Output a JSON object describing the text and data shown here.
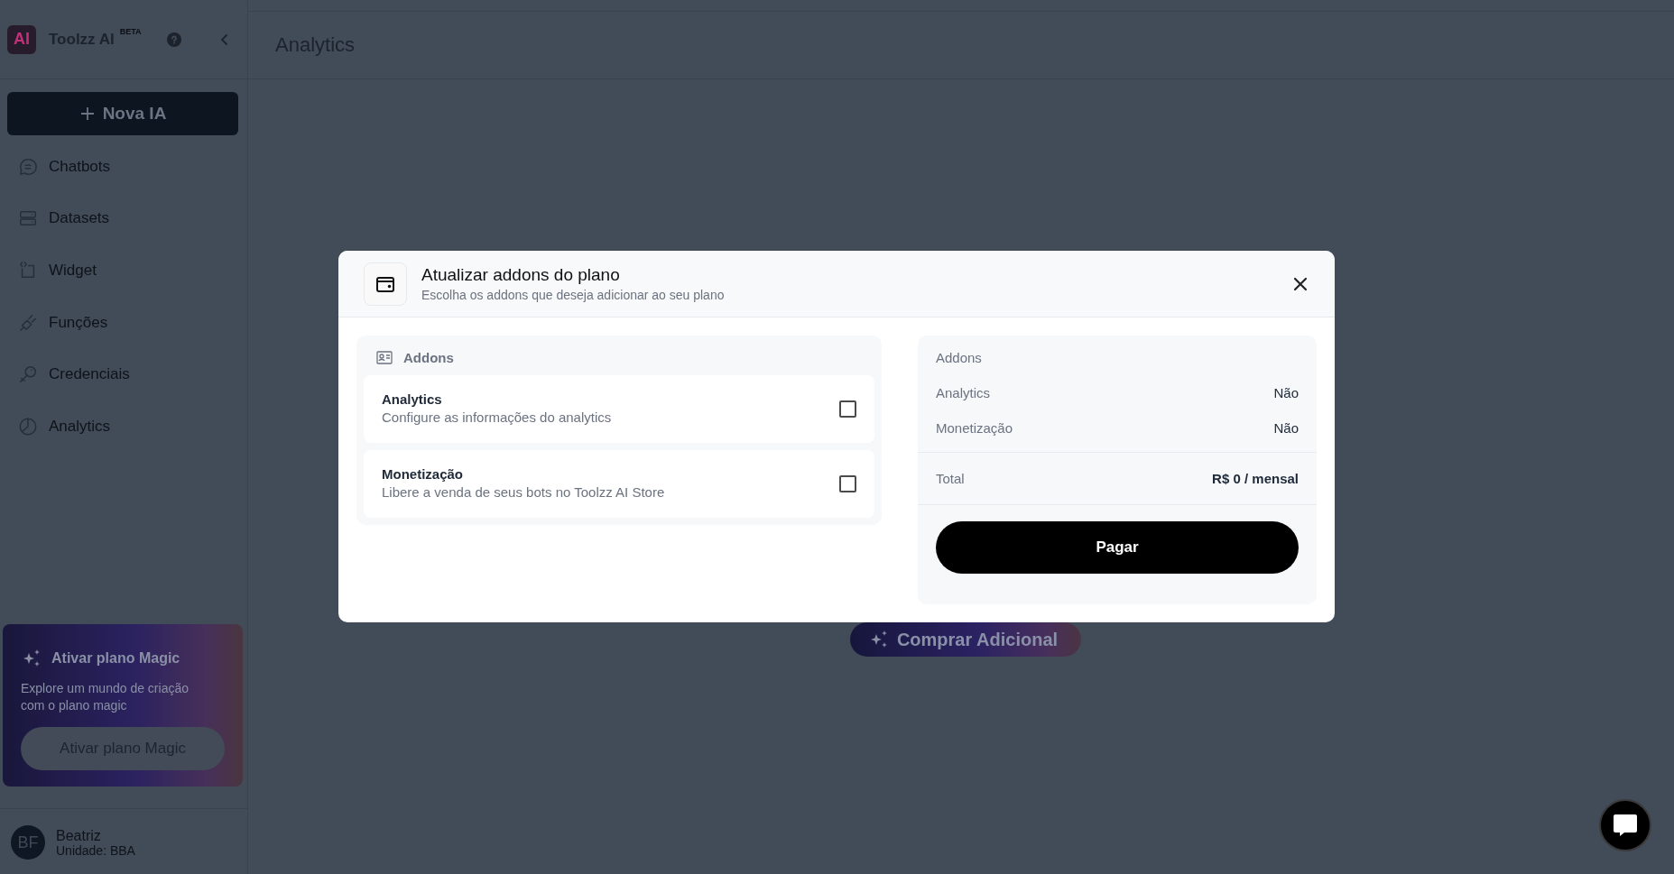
{
  "sidebar": {
    "logo": "AI",
    "brand": "Toolzz AI",
    "badge": "BETA",
    "new_button": "Nova IA",
    "items": [
      {
        "label": "Chatbots"
      },
      {
        "label": "Datasets"
      },
      {
        "label": "Widget"
      },
      {
        "label": "Funções"
      },
      {
        "label": "Credenciais"
      },
      {
        "label": "Analytics"
      }
    ],
    "promo": {
      "title": "Ativar plano Magic",
      "text": "Explore um mundo de criação com o plano magic",
      "button": "Ativar plano Magic"
    },
    "user": {
      "initials": "BF",
      "name": "Beatriz",
      "unit": "Unidade: BBA"
    }
  },
  "page": {
    "title": "Analytics",
    "button": "Comprar Adicional"
  },
  "modal": {
    "title": "Atualizar addons do plano",
    "subtitle": "Escolha os addons que deseja adicionar ao seu plano",
    "section": "Addons",
    "addons": [
      {
        "name": "Analytics",
        "description": "Configure as informações do analytics",
        "checked": false
      },
      {
        "name": "Monetização",
        "description": "Libere a venda de seus bots no Toolzz AI Store",
        "checked": false
      }
    ],
    "summary": {
      "heading": "Addons",
      "rows": [
        {
          "label": "Analytics",
          "value": "Não"
        },
        {
          "label": "Monetização",
          "value": "Não"
        }
      ],
      "total_label": "Total",
      "total_value": "R$ 0 / mensal",
      "button": "Pagar"
    }
  }
}
